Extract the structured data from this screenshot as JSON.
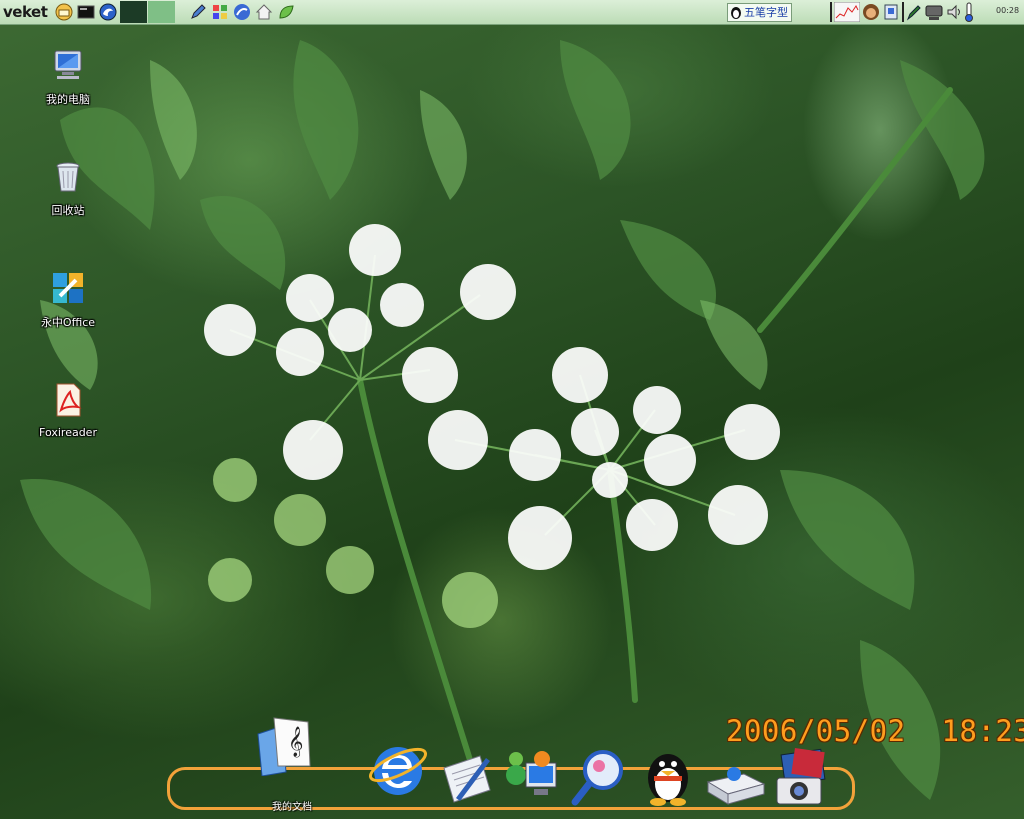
{
  "top_panel": {
    "brand": "veket",
    "launchers": [
      "home-icon",
      "terminal-icon",
      "firefox-icon"
    ],
    "quicklaunch": [
      "pen-icon",
      "puzzle-icon",
      "browser-icon",
      "house-icon",
      "leaf-icon"
    ],
    "ime_label": "五笔字型",
    "tray": [
      "cpu-monitor-icon",
      "user-face-icon",
      "clipboard-icon",
      "pencil-icon",
      "network-icon",
      "volume-icon",
      "thermometer-icon"
    ],
    "time": "00:28"
  },
  "desktop_icons": [
    {
      "name": "我的电脑",
      "icon": "computer-icon"
    },
    {
      "name": "回收站",
      "icon": "trash-icon"
    },
    {
      "name": "永中Office",
      "icon": "office-icon"
    },
    {
      "name": "Foxireader",
      "icon": "pdf-reader-icon"
    }
  ],
  "clock": {
    "date": "2006/05/02",
    "time": "18:23"
  },
  "dock": {
    "hover_label": "我的文档",
    "items": [
      "documents-icon",
      "internet-explorer-icon",
      "text-editor-icon",
      "messenger-icon",
      "search-icon",
      "qq-penguin-icon",
      "drive-icon",
      "photo-camera-icon"
    ]
  },
  "colors": {
    "panel": "#c6e3c0",
    "clock": "#ff9d1e",
    "dock_border": "#f2a23a"
  }
}
